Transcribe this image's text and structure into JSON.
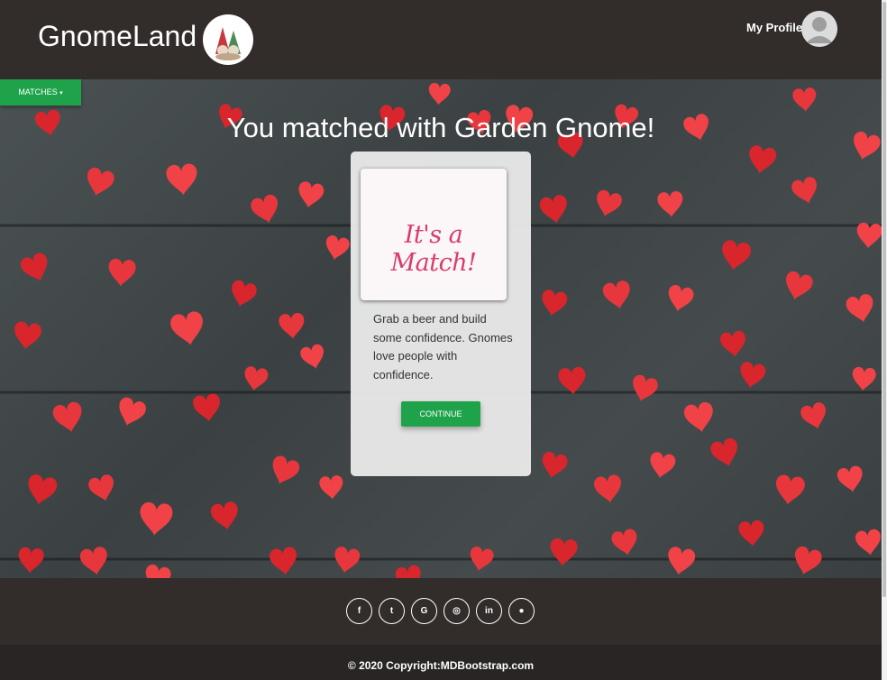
{
  "header": {
    "brand": "GnomeLand",
    "profile_label": "My Profile"
  },
  "main": {
    "matches_label": "MATCHES",
    "headline": "You matched with Garden Gnome!",
    "card": {
      "image_text": "It's a Match!",
      "body": "Grab a beer and build some confidence. Gnomes love people with confidence.",
      "button_label": "CONTINUE"
    }
  },
  "footer": {
    "social": [
      {
        "icon": "facebook-icon",
        "glyph": "f"
      },
      {
        "icon": "twitter-icon",
        "glyph": "t"
      },
      {
        "icon": "google-icon",
        "glyph": "G"
      },
      {
        "icon": "instagram-icon",
        "glyph": "◎"
      },
      {
        "icon": "linkedin-icon",
        "glyph": "in"
      },
      {
        "icon": "github-icon",
        "glyph": "●"
      }
    ],
    "copyright": "© 2020 Copyright:MDBootstrap.com"
  },
  "colors": {
    "navbar": "#322c2b",
    "accent_green": "#1ea34a",
    "heart_red": "#e0383e",
    "match_pink": "#d93c6b"
  }
}
